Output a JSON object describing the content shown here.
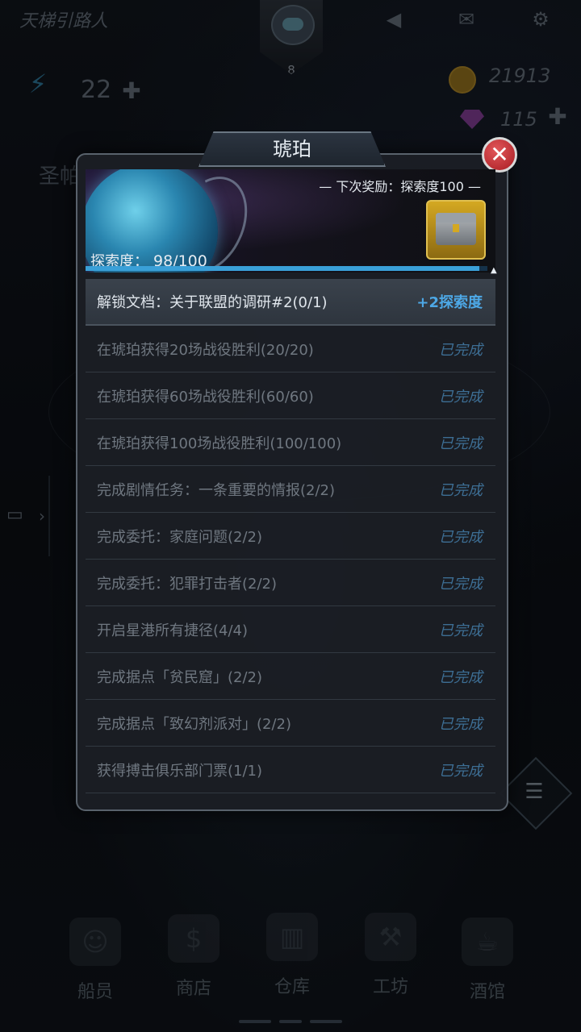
{
  "topbar": {
    "player_name": "天梯引路人",
    "level": "8",
    "energy": "22",
    "coins": "21913",
    "gems": "115",
    "icons": {
      "sound": "speaker-icon",
      "mail": "envelope-icon",
      "settings": "gear-icon"
    }
  },
  "background_text": "圣帕",
  "dialog": {
    "title": "琥珀",
    "next_reward_label": "— 下次奖励：探索度100 —",
    "progress_label": "探索度：",
    "progress_value": "98/100",
    "progress_fraction": 0.98,
    "tasks": [
      {
        "text": "解锁文档：关于联盟的调研#2(0/1)",
        "status": "+2探索度",
        "active": true
      },
      {
        "text": "在琥珀获得20场战役胜利(20/20)",
        "status": "已完成"
      },
      {
        "text": "在琥珀获得60场战役胜利(60/60)",
        "status": "已完成"
      },
      {
        "text": "在琥珀获得100场战役胜利(100/100)",
        "status": "已完成"
      },
      {
        "text": "完成剧情任务：一条重要的情报(2/2)",
        "status": "已完成"
      },
      {
        "text": "完成委托：家庭问题(2/2)",
        "status": "已完成"
      },
      {
        "text": "完成委托：犯罪打击者(2/2)",
        "status": "已完成"
      },
      {
        "text": "开启星港所有捷径(4/4)",
        "status": "已完成"
      },
      {
        "text": "完成据点「贫民窟」(2/2)",
        "status": "已完成"
      },
      {
        "text": "完成据点「致幻剂派对」(2/2)",
        "status": "已完成"
      },
      {
        "text": "获得搏击俱乐部门票(1/1)",
        "status": "已完成"
      }
    ]
  },
  "bottom_nav": [
    {
      "label": "船员",
      "icon": "crew-icon"
    },
    {
      "label": "商店",
      "icon": "shop-icon"
    },
    {
      "label": "仓库",
      "icon": "warehouse-icon"
    },
    {
      "label": "工坊",
      "icon": "workshop-icon"
    },
    {
      "label": "酒馆",
      "icon": "tavern-icon"
    }
  ],
  "colors": {
    "accent": "#3aa0d8",
    "completed": "#3d6e94",
    "close": "#c8262c"
  }
}
